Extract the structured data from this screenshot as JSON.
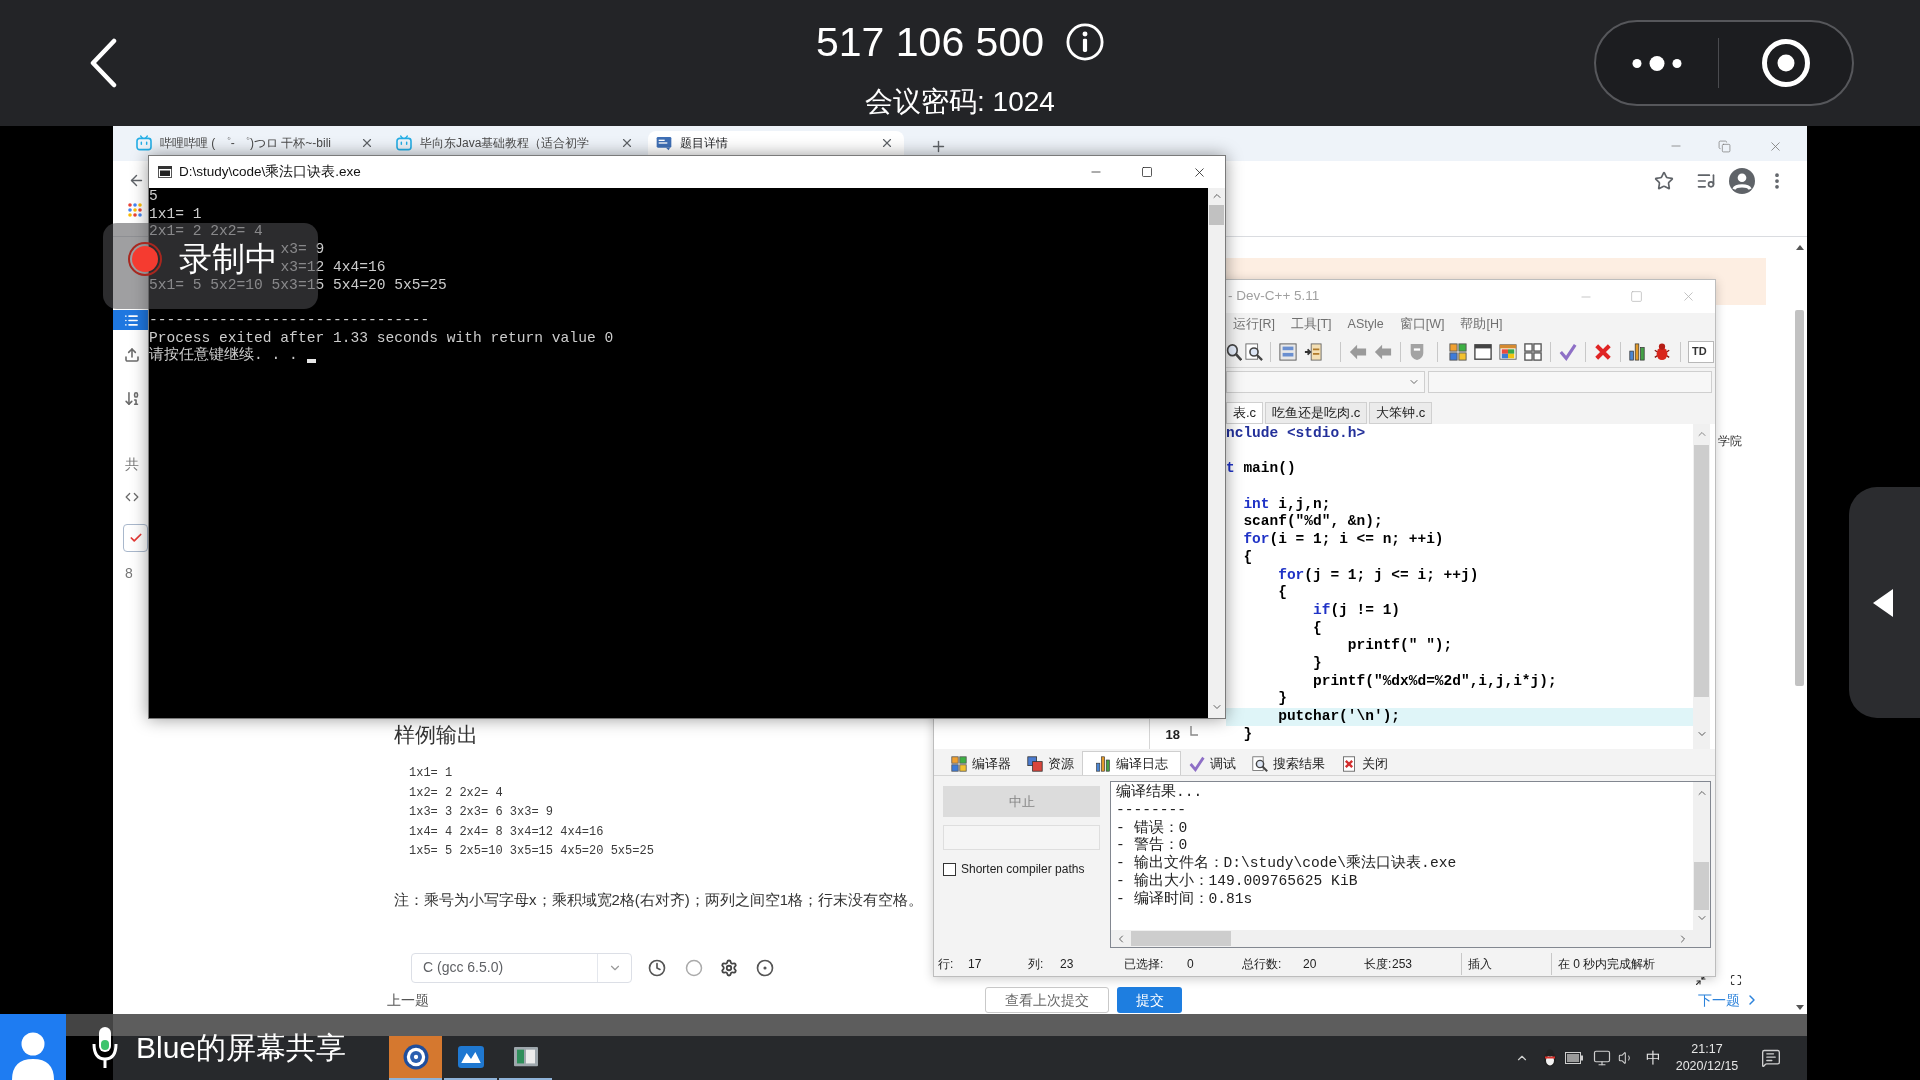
{
  "meeting": {
    "meeting_id": "517 106 500",
    "password": "会议密码: 1024",
    "recording": "录制中",
    "presenter": "Blue的屏幕共享"
  },
  "browser": {
    "tabs": [
      {
        "title": "哔哩哔哩 ( ゜- ゜)つロ 干杯~-bili",
        "selected": false
      },
      {
        "title": "毕向东Java基础教程（适合初学",
        "selected": false
      },
      {
        "title": "题目详情",
        "selected": true
      }
    ]
  },
  "page": {
    "sidebar": [
      {
        "kind": "list",
        "selected": true
      },
      {
        "kind": "upload",
        "selected": false
      },
      {
        "kind": "sort",
        "selected": false
      },
      {
        "kind": "text",
        "label": "共",
        "selected": false
      },
      {
        "kind": "code",
        "selected": false
      },
      {
        "kind": "check",
        "selected": false
      },
      {
        "kind": "text",
        "label": "8",
        "selected": false
      }
    ],
    "side_text": "学院",
    "sample_output": {
      "heading": "样例输出",
      "lines": [
        "1x1= 1",
        "1x2= 2 2x2= 4",
        "1x3= 3 2x3= 6 3x3= 9",
        "1x4= 4 2x4= 8 3x4=12 4x4=16",
        "1x5= 5 2x5=10 3x5=15 4x5=20 5x5=25"
      ]
    },
    "note": "注：乘号为小写字母x；乘积域宽2格(右对齐)；两列之间空1格；行末没有空格。",
    "language": "C (gcc 6.5.0)",
    "footer": {
      "previous": "上一题",
      "history_button": "查看上次提交",
      "submit_button": "提交",
      "next": "下一题"
    }
  },
  "console": {
    "title": "D:\\study\\code\\乘法口诀表.exe",
    "lines": [
      {
        "kind": "whole",
        "text": "5"
      },
      {
        "kind": "whole",
        "text": "1x1= 1"
      },
      {
        "kind": "whole",
        "text": "2x1= 2 2x2= 4"
      },
      {
        "kind": "covered_start",
        "text": "x3= 9"
      },
      {
        "kind": "covered_start",
        "text": "x3=12 4x4=16"
      },
      {
        "kind": "whole",
        "text": "5x1= 5 5x2=10 5x3=15 5x4=20 5x5=25"
      },
      {
        "kind": "blank"
      },
      {
        "kind": "whole",
        "text": "--------------------------------"
      },
      {
        "kind": "whole",
        "text": "Process exited after 1.33 seconds with return value 0"
      },
      {
        "kind": "whole",
        "text": "请按任意键继续. . ."
      }
    ]
  },
  "ide": {
    "title": "- Dev-C++ 5.11",
    "menu": [
      "运行[R]",
      "工具[T]",
      "AStyle",
      "窗口[W]",
      "帮助[H]"
    ],
    "compiler_box": "TD",
    "file_tabs": [
      {
        "label": "表.c",
        "selected": true
      },
      {
        "label": "吃鱼还是吃肉.c",
        "selected": false
      },
      {
        "label": "大笨钟.c",
        "selected": false
      }
    ],
    "code": [
      {
        "kind": "code",
        "segments": [
          {
            "kind": "preprocessor",
            "text": "nclude <stdio.h>"
          }
        ],
        "current": false
      },
      {
        "kind": "blank"
      },
      {
        "kind": "code",
        "segments": [
          {
            "kind": "keyword",
            "text": "t"
          },
          {
            "kind": "plain",
            "text": " main()"
          }
        ],
        "current": false
      },
      {
        "kind": "blank"
      },
      {
        "kind": "code",
        "segments": [
          {
            "kind": "keyword",
            "text": "  int"
          },
          {
            "kind": "plain",
            "text": " i,j,n;"
          }
        ],
        "current": false
      },
      {
        "kind": "code",
        "segments": [
          {
            "kind": "plain",
            "text": "  scanf(\"%d\", &n);"
          }
        ],
        "current": false
      },
      {
        "kind": "code",
        "segments": [
          {
            "kind": "keyword",
            "text": "  for"
          },
          {
            "kind": "plain",
            "text": "(i = 1; i <= n; ++i)"
          }
        ],
        "current": false
      },
      {
        "kind": "code",
        "segments": [
          {
            "kind": "plain",
            "text": "  {"
          }
        ],
        "current": false
      },
      {
        "kind": "code",
        "segments": [
          {
            "kind": "keyword",
            "text": "      for"
          },
          {
            "kind": "plain",
            "text": "(j = 1; j <= i; ++j)"
          }
        ],
        "current": false
      },
      {
        "kind": "code",
        "segments": [
          {
            "kind": "plain",
            "text": "      {"
          }
        ],
        "current": false
      },
      {
        "kind": "code",
        "segments": [
          {
            "kind": "keyword",
            "text": "          if"
          },
          {
            "kind": "plain",
            "text": "(j != 1)"
          }
        ],
        "current": false
      },
      {
        "kind": "code",
        "segments": [
          {
            "kind": "plain",
            "text": "          {"
          }
        ],
        "current": false
      },
      {
        "kind": "code",
        "segments": [
          {
            "kind": "plain",
            "text": "              printf(\" \");"
          }
        ],
        "current": false
      },
      {
        "kind": "code",
        "segments": [
          {
            "kind": "plain",
            "text": "          }"
          }
        ],
        "current": false
      },
      {
        "kind": "code",
        "segments": [
          {
            "kind": "plain",
            "text": "          printf(\"%dx%d=%2d\",i,j,i*j);"
          }
        ],
        "current": false
      },
      {
        "kind": "code",
        "segments": [
          {
            "kind": "plain",
            "text": "      }"
          }
        ],
        "current": false
      },
      {
        "kind": "code",
        "segments": [
          {
            "kind": "plain",
            "text": "      putchar('\\n');"
          }
        ],
        "current": true
      },
      {
        "kind": "code",
        "number": "18",
        "segments": [
          {
            "kind": "plain",
            "text": "  }"
          }
        ],
        "current": false
      }
    ],
    "bottom_tabs": [
      {
        "label": "编译器",
        "selected": false
      },
      {
        "label": "资源",
        "selected": false
      },
      {
        "label": "编译日志",
        "selected": true
      },
      {
        "label": "调试",
        "selected": false
      },
      {
        "label": "搜索结果",
        "selected": false
      },
      {
        "label": "关闭",
        "selected": false
      }
    ],
    "abort_button": {
      "label": "中止",
      "disabled": true
    },
    "shorten_paths": {
      "label": "Shorten compiler paths",
      "checked": false
    },
    "log": [
      "编译结果...",
      "--------",
      "- 错误：0",
      "- 警告：0",
      "- 输出文件名：D:\\study\\code\\乘法口诀表.exe",
      "- 输出大小：149.009765625 KiB",
      "- 编译时间：0.81s"
    ],
    "status": [
      {
        "label": "行:",
        "value": "17"
      },
      {
        "label": "列:",
        "value": "23"
      },
      {
        "label": "已选择:",
        "value": "0"
      },
      {
        "label": "总行数:",
        "value": "20"
      },
      {
        "label": "长度:",
        "value": "253"
      },
      {
        "label": "插入"
      },
      {
        "label": "在 0 秒内完成解析"
      }
    ]
  },
  "taskbar": {
    "apps": [
      {
        "kind": "emblem",
        "highlighted": true
      },
      {
        "kind": "mountain",
        "highlighted": false
      },
      {
        "kind": "window",
        "highlighted": false
      }
    ],
    "ime": "中",
    "time": "21:17",
    "date": "2020/12/15"
  }
}
